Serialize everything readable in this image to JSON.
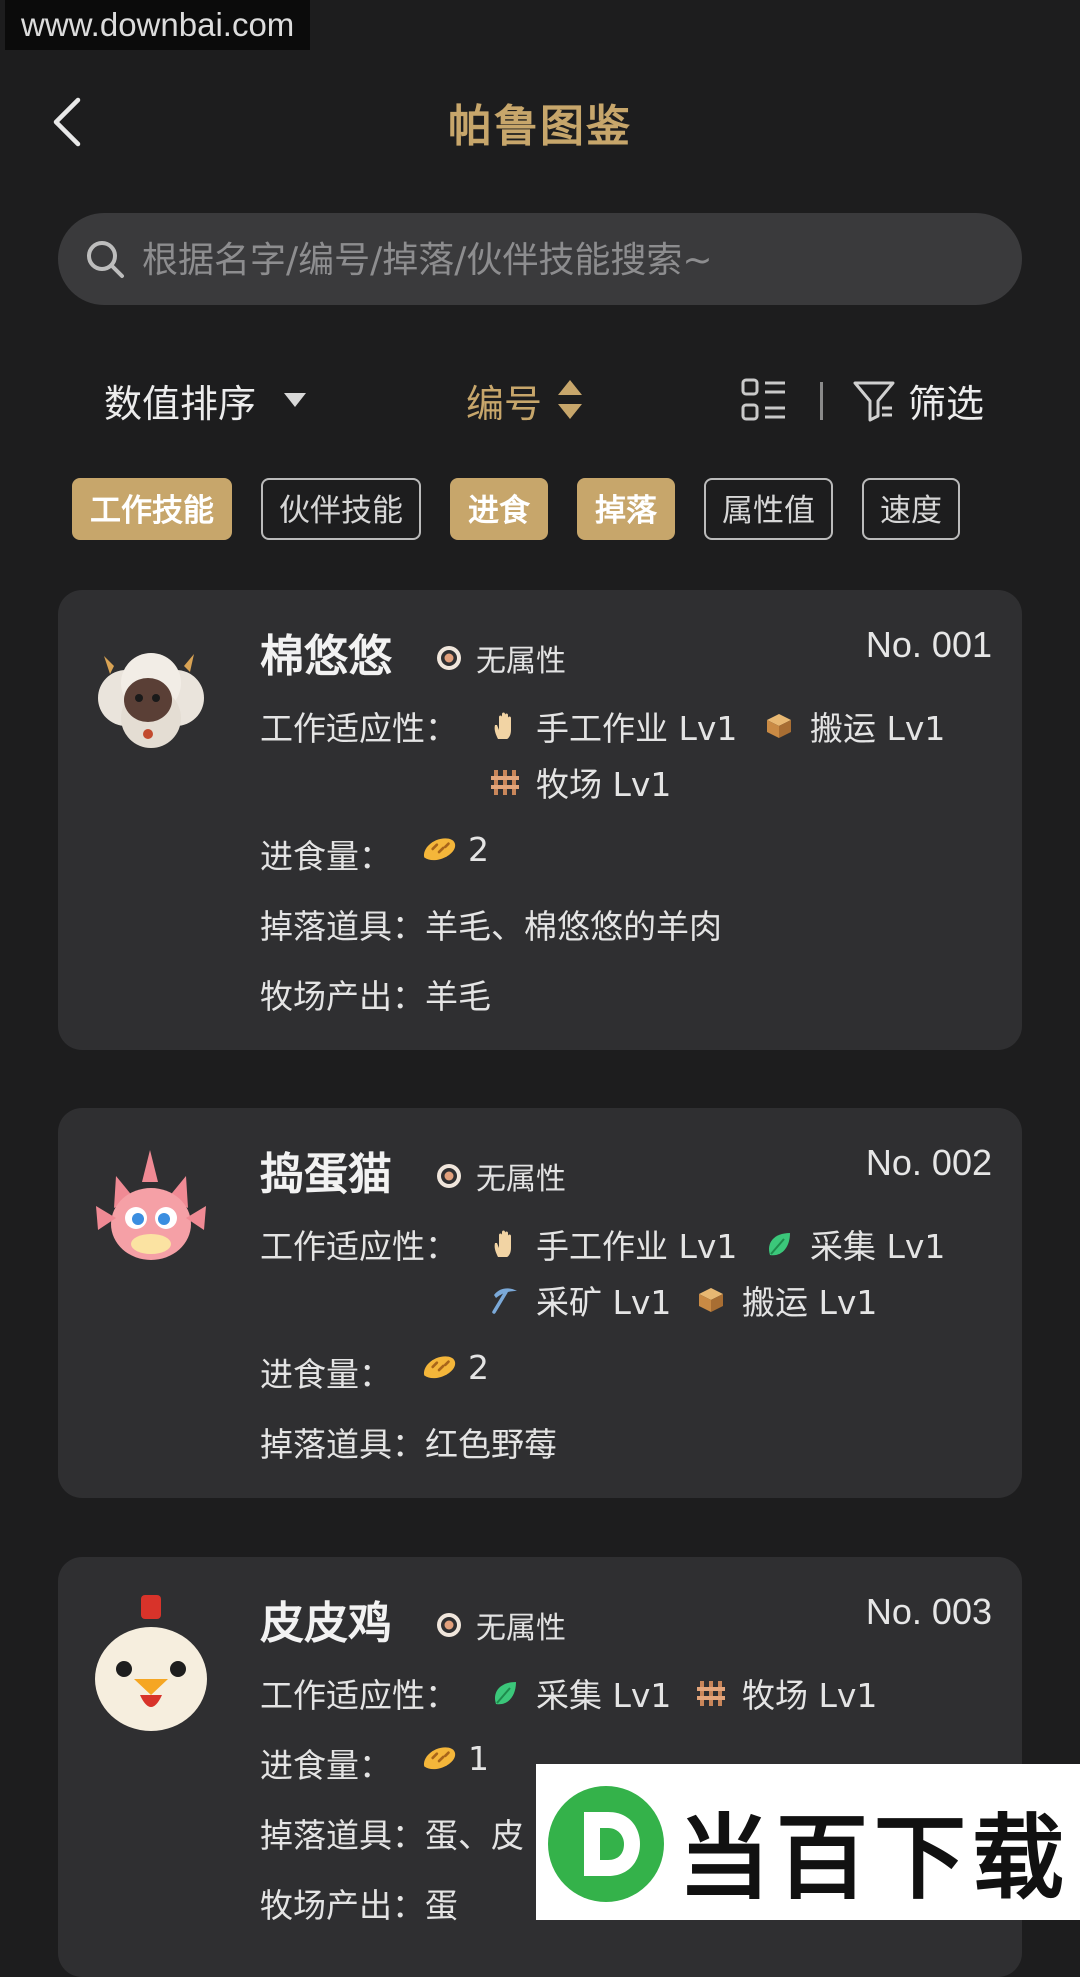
{
  "watermark": "www.downbai.com",
  "header": {
    "title": "帕鲁图鉴"
  },
  "search": {
    "placeholder": "根据名字/编号/掉落/伙伴技能搜索~"
  },
  "toolbar": {
    "sort_label": "数值排序",
    "number_label": "编号",
    "filter_label": "筛选"
  },
  "chips": [
    {
      "label": "工作技能",
      "active": true
    },
    {
      "label": "伙伴技能",
      "active": false
    },
    {
      "label": "进食",
      "active": true
    },
    {
      "label": "掉落",
      "active": true
    },
    {
      "label": "属性值",
      "active": false
    },
    {
      "label": "速度",
      "active": false
    }
  ],
  "labels": {
    "work": "工作适应性：",
    "food": "进食量：",
    "drop": "掉落道具：",
    "ranch": "牧场产出："
  },
  "pals": [
    {
      "name": "棉悠悠",
      "attr": "无属性",
      "number": "No. 001",
      "skills": [
        {
          "icon": "hand-icon",
          "label": "手工作业 Lv1"
        },
        {
          "icon": "box-icon",
          "label": "搬运 Lv1"
        },
        {
          "icon": "fence-icon",
          "label": "牧场 Lv1"
        }
      ],
      "food": "2",
      "drops": "羊毛、棉悠悠的羊肉",
      "ranch": "羊毛"
    },
    {
      "name": "捣蛋猫",
      "attr": "无属性",
      "number": "No. 002",
      "skills": [
        {
          "icon": "hand-icon",
          "label": "手工作业 Lv1"
        },
        {
          "icon": "leaf-icon",
          "label": "采集 Lv1"
        },
        {
          "icon": "pickaxe-icon",
          "label": "采矿 Lv1"
        },
        {
          "icon": "box-icon",
          "label": "搬运 Lv1"
        }
      ],
      "food": "2",
      "drops": "红色野莓"
    },
    {
      "name": "皮皮鸡",
      "attr": "无属性",
      "number": "No. 003",
      "skills": [
        {
          "icon": "leaf-icon",
          "label": "采集 Lv1"
        },
        {
          "icon": "fence-icon",
          "label": "牧场 Lv1"
        }
      ],
      "food": "1",
      "drops": "蛋、皮",
      "ranch": "蛋"
    }
  ],
  "brand": {
    "text": "当百下载"
  },
  "colors": {
    "accent": "#c7a66b",
    "background": "#1d1d1e",
    "card": "#2f2f31"
  }
}
